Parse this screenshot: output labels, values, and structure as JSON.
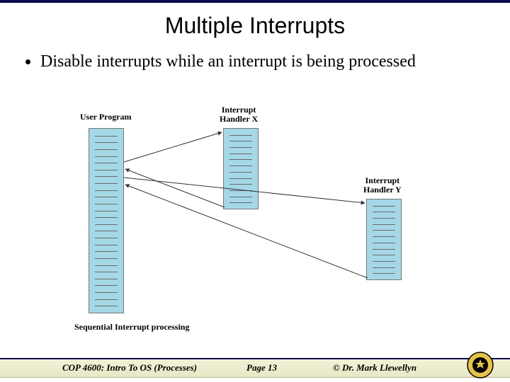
{
  "title": "Multiple Interrupts",
  "bullet1": "Disable interrupts while an interrupt is being processed",
  "diagram": {
    "label_user": "User Program",
    "label_hx": "Interrupt\nHandler X",
    "label_hy": "Interrupt\nHandler Y",
    "caption": "Sequential Interrupt processing"
  },
  "footer": {
    "left": "COP 4600: Intro To OS  (Processes)",
    "mid": "Page 13",
    "right": "© Dr. Mark Llewellyn"
  }
}
